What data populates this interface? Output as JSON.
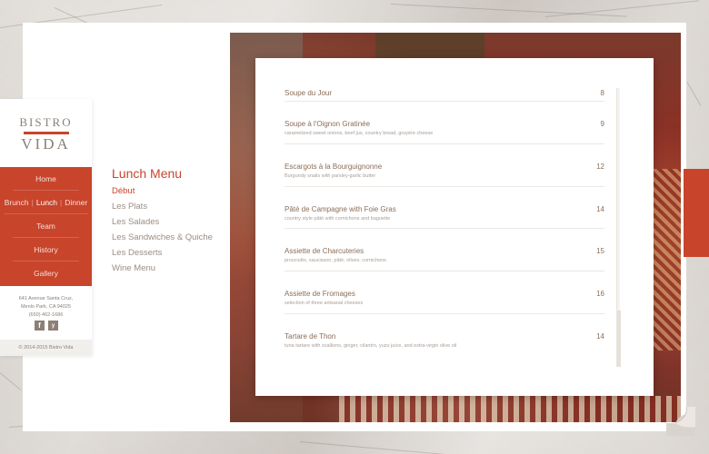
{
  "brand": {
    "name_top": "BISTRO",
    "name_bottom": "VIDA",
    "accent_color": "#c8442b"
  },
  "nav": {
    "home": "Home",
    "meals": [
      "Brunch",
      "Lunch",
      "Dinner"
    ],
    "active_meal": "Lunch",
    "team": "Team",
    "history": "History",
    "gallery": "Gallery"
  },
  "contact": {
    "address_line1": "641 Avenue Santa Cruz,",
    "address_line2": "Menlo Park, CA 94025",
    "phone": "(650) 462-1686",
    "social_icons": [
      "facebook-icon",
      "yelp-icon"
    ]
  },
  "footer": {
    "copyright": "© 2014-2015 Bistro Vida"
  },
  "section_menu": {
    "title": "Lunch Menu",
    "items": [
      "Début",
      "Les Plats",
      "Les Salades",
      "Les Sandwiches & Quiche",
      "Les Desserts",
      "Wine Menu"
    ],
    "active_item": "Début"
  },
  "dishes": [
    {
      "name": "Soupe du Jour",
      "description": "",
      "price": "8"
    },
    {
      "name": "Soupe à l'Oignon Gratinée",
      "description": "caramelized sweet onions, beef jus, country bread, gruyère cheese",
      "price": "9"
    },
    {
      "name": "Escargots à la Bourguignonne",
      "description": "Burgundy snails with parsley-garlic butter",
      "price": "12"
    },
    {
      "name": "Pâté de Campagne with Foie Gras",
      "description": "country style pâté with cornichons and baguette",
      "price": "14"
    },
    {
      "name": "Assiette de Charcuteries",
      "description": "prosciutto, saucisson, pâté, olives, cornichons",
      "price": "15"
    },
    {
      "name": "Assiette de Fromages",
      "description": "selection of three artisanal cheeses",
      "price": "16"
    },
    {
      "name": "Tartare de Thon",
      "description": "tuna tartare with scallions, ginger, cilantro, yuzu juice, and extra-virgin olive oil",
      "price": "14"
    }
  ]
}
